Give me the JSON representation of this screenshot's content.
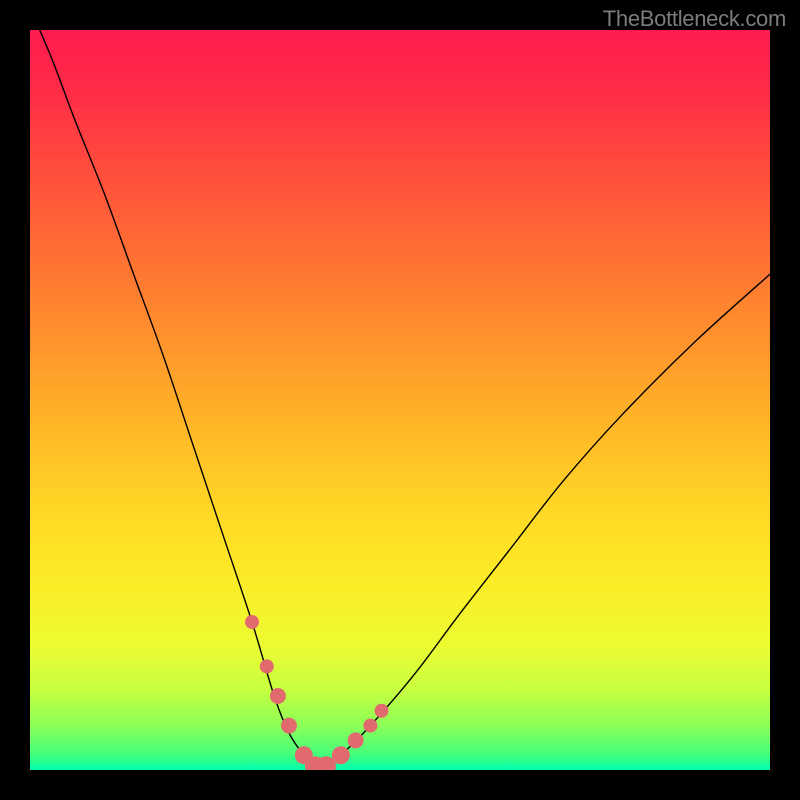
{
  "watermark_text": "TheBottleneck.com",
  "chart_data": {
    "type": "line",
    "title": "",
    "xlabel": "",
    "ylabel": "",
    "xlim": [
      0,
      100
    ],
    "ylim": [
      0,
      100
    ],
    "grid": false,
    "legend": null,
    "series": [
      {
        "name": "bottleneck-curve",
        "x": [
          0,
          3,
          6,
          10,
          14,
          18,
          22,
          26,
          30,
          33,
          35,
          37,
          38.5,
          40,
          42,
          46,
          52,
          58,
          65,
          72,
          80,
          90,
          100
        ],
        "values": [
          103,
          96,
          88,
          78,
          67,
          56,
          44,
          32,
          20,
          10,
          5,
          2,
          0.5,
          0.5,
          2,
          6,
          13,
          21,
          30,
          39,
          48,
          58,
          67
        ]
      }
    ],
    "markers": {
      "name": "highlight-points",
      "color": "#e16a6e",
      "x": [
        30,
        32,
        33.5,
        35,
        37,
        38.5,
        40,
        42,
        44,
        46,
        47.5
      ],
      "values": [
        20,
        14,
        10,
        6,
        2,
        0.5,
        0.5,
        2,
        4,
        6,
        8
      ],
      "sizes": [
        7,
        7,
        8,
        8,
        9,
        10,
        10,
        9,
        8,
        7,
        7
      ]
    },
    "gradient_stops": [
      {
        "pos": 0,
        "color": "#ff1b4f"
      },
      {
        "pos": 50,
        "color": "#ffb827"
      },
      {
        "pos": 83,
        "color": "#edfb31"
      },
      {
        "pos": 100,
        "color": "#00ffb0"
      }
    ]
  }
}
